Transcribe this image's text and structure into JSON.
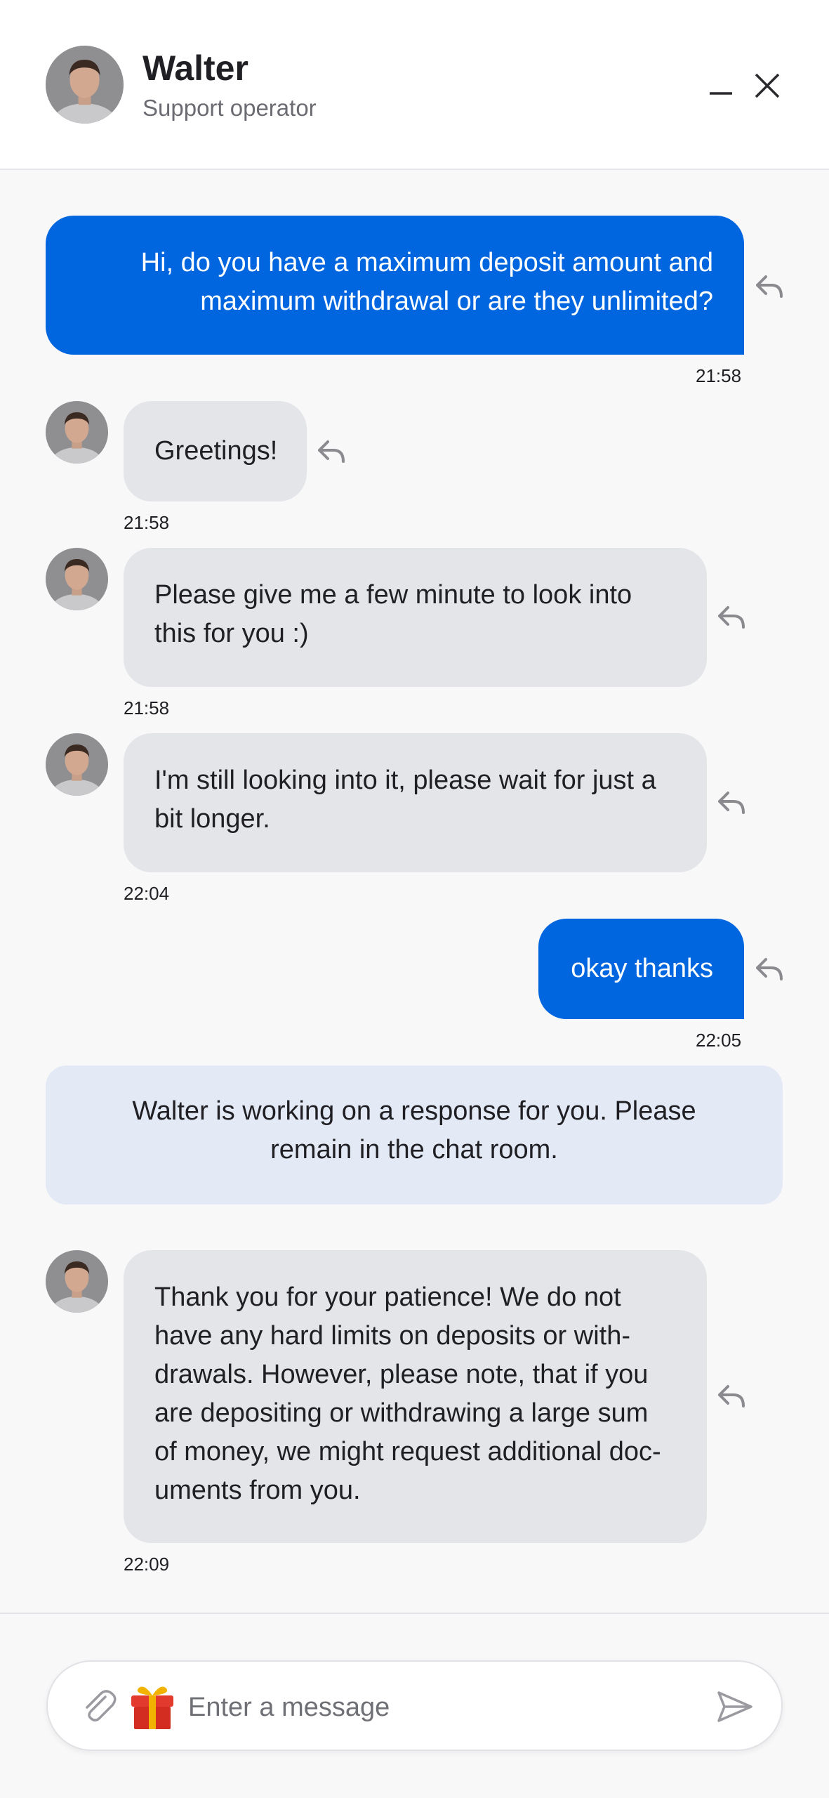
{
  "header": {
    "operator_name": "Walter",
    "operator_role": "Support operator"
  },
  "messages": [
    {
      "from": "user",
      "text": "Hi, do you have a maximum deposit amount and maximum withdrawal or are they unlimited?",
      "time": "21:58"
    },
    {
      "from": "operator",
      "text": "Greetings!",
      "time": "21:58"
    },
    {
      "from": "operator",
      "text": "Please give me a few minute to look into this for you :)",
      "time": "21:58"
    },
    {
      "from": "operator",
      "text": "I'm still looking into it, please wait for just a bit longer.",
      "time": "22:04"
    },
    {
      "from": "user",
      "text": "okay thanks",
      "time": "22:05"
    },
    {
      "from": "operator",
      "text": "Thank you for your patience! We do not have any hard limits on deposits or with- drawals. However, please note, that if you are depositing or withdrawing a large sum of money, we might request additional doc- uments from you.",
      "time": "22:09"
    }
  ],
  "notice": {
    "text": "Walter is working on a response for you. Please remain in the chat room."
  },
  "composer": {
    "placeholder": "Enter a message"
  },
  "colors": {
    "accent": "#0066e0",
    "incoming_bubble": "#e4e5e9",
    "notice_bg": "#e3e9f5",
    "background": "#f8f8f9"
  },
  "icons": [
    "minimize-icon",
    "close-icon",
    "reply-icon",
    "paperclip-icon",
    "gift-icon",
    "send-icon"
  ]
}
